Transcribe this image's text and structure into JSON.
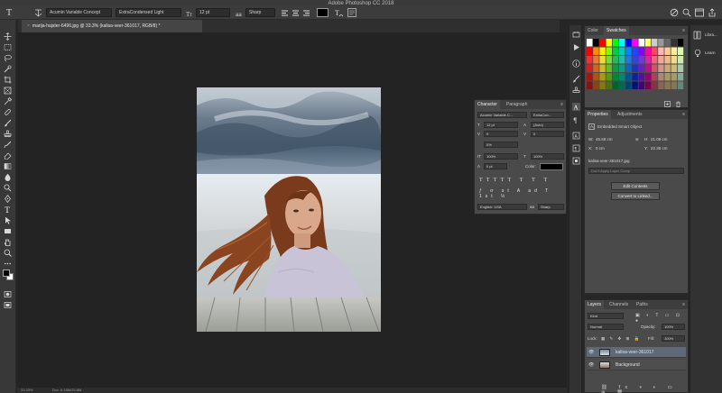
{
  "app": {
    "title": "Adobe Photoshop CC 2018"
  },
  "options_bar": {
    "font_family": "Acumin Variable Concept",
    "font_style": "ExtraCondensed Light",
    "font_size": "12 pt",
    "antialias": "Sharp",
    "text_color": "#000000"
  },
  "document_tab": {
    "label": "marija-hajster-6496.jpg @ 33.3% (kalisa-veer-361017, RGB/8) *"
  },
  "character_panel": {
    "tabs": [
      "Character",
      "Paragraph"
    ],
    "font_family": "Acumin Variable C...",
    "font_style": "ExtraCon...",
    "font_size": "12 pt",
    "leading": "(Auto)",
    "kerning": "0",
    "tracking": "0",
    "tsume": "0%",
    "vertical_scale": "100%",
    "horizontal_scale": "100%",
    "baseline_shift": "0 pt",
    "color_label": "Color:",
    "language": "English: USA",
    "antialias": "Sharp"
  },
  "color_panel": {
    "tabs": [
      "Color",
      "Swatches"
    ]
  },
  "properties_panel": {
    "tabs": [
      "Properties",
      "Adjustments"
    ],
    "object_type": "Embedded Smart Object",
    "w_label": "W:",
    "w_value": "45.68 cm",
    "h_label": "H:",
    "h_value": "21.08 cm",
    "x_label": "X:",
    "x_value": "0 cm",
    "y_label": "Y:",
    "y_value": "22.38 cm",
    "file_name": "kalisa-veer-361017.jpg",
    "comp_placeholder": "Don't Apply Layer Comp",
    "edit_contents": "Edit Contents",
    "convert_linked": "Convert to Linked..."
  },
  "layers_panel": {
    "tabs": [
      "Layers",
      "Channels",
      "Paths"
    ],
    "filter_kind": "Kind",
    "blend_mode": "Normal",
    "opacity_label": "Opacity:",
    "opacity_value": "100%",
    "lock_label": "Lock:",
    "fill_label": "Fill:",
    "fill_value": "100%",
    "layers": [
      {
        "name": "kalisa-veer-361017",
        "selected": true
      },
      {
        "name": "Background",
        "selected": false
      }
    ]
  },
  "library_strip": {
    "items": [
      "Libra...",
      "Learn"
    ]
  },
  "status_bar": {
    "zoom": "33.33%",
    "doc_info": "Doc: 6.18M/25.8M"
  },
  "icons": [
    "type-tool-icon",
    "move-tool-icon",
    "marquee-icon",
    "lasso-icon",
    "quick-select-icon",
    "crop-icon",
    "eyedropper-icon",
    "healing-icon",
    "brush-icon",
    "stamp-icon",
    "history-brush-icon",
    "eraser-icon",
    "gradient-icon",
    "blur-icon",
    "dodge-icon",
    "pen-icon",
    "text-icon",
    "path-select-icon",
    "shape-icon",
    "hand-icon",
    "zoom-icon"
  ],
  "colors": {
    "accent": "#5f6a78",
    "panel": "#4a4a4a",
    "canvas": "#232323"
  }
}
